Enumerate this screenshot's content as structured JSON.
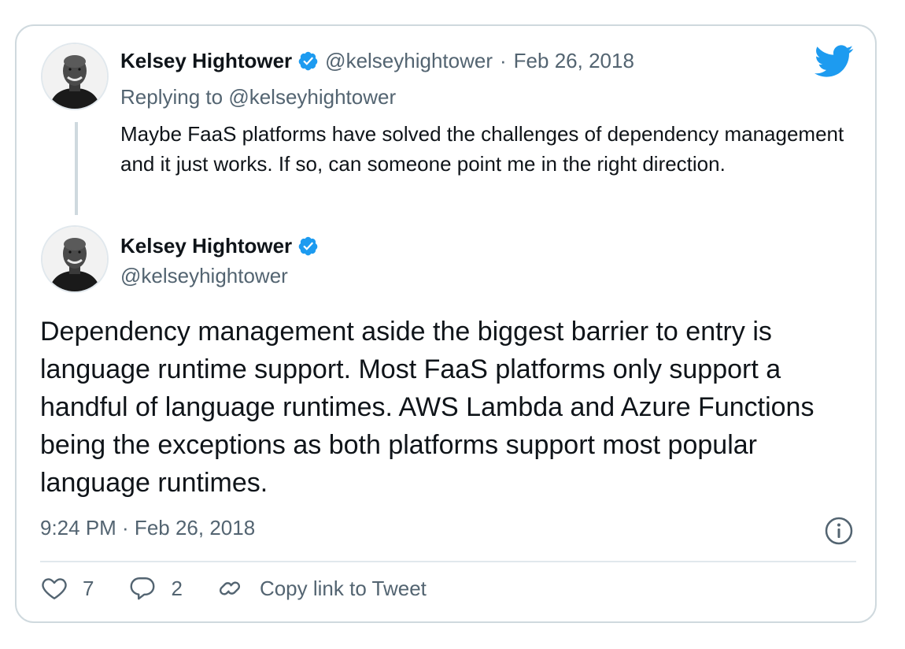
{
  "colors": {
    "verified": "#1d9bf0",
    "twitter_blue": "#1d9bf0",
    "secondary_text": "#536471",
    "border": "#cfd9de"
  },
  "icons": {
    "brand": "twitter-bird-icon",
    "verified": "verified-badge-icon",
    "info": "info-icon",
    "like": "heart-icon",
    "reply": "reply-bubble-icon",
    "copy_link": "link-icon"
  },
  "parent_tweet": {
    "author_name": "Kelsey Hightower",
    "handle": "@kelseyhightower",
    "separator": "·",
    "date": "Feb 26, 2018",
    "replying_prefix": "Replying to",
    "replying_to": "@kelseyhightower",
    "text": "Maybe FaaS platforms have solved the challenges of dependency management and it just works. If so, can someone point me in the right direction."
  },
  "main_tweet": {
    "author_name": "Kelsey Hightower",
    "handle": "@kelseyhightower",
    "text": "Dependency management aside the biggest barrier to entry is language runtime support. Most FaaS platforms only support a handful of language runtimes. AWS Lambda and Azure Functions being the exceptions as both platforms support most popular language runtimes.",
    "timestamp": "9:24 PM · Feb 26, 2018"
  },
  "actions": {
    "like_count": "7",
    "reply_count": "2",
    "copy_link_label": "Copy link to Tweet"
  }
}
